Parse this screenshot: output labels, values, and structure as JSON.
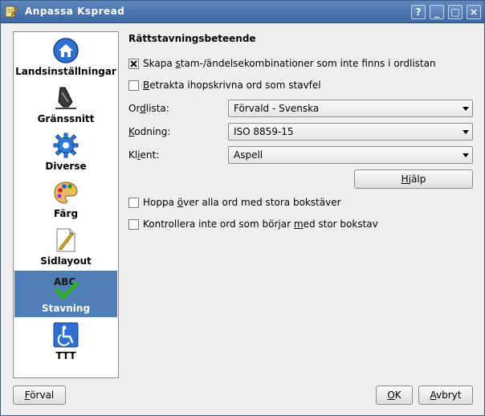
{
  "window": {
    "title": "Anpassa Kspread"
  },
  "titlebar_buttons": {
    "help": "?",
    "minimize": "_",
    "maximize": "□",
    "close": "×"
  },
  "sidebar": {
    "items": [
      {
        "label": "Landsinställningar",
        "icon": "home-icon"
      },
      {
        "label": "Gränssnitt",
        "icon": "pen-nib-icon"
      },
      {
        "label": "Diverse",
        "icon": "gear-icon"
      },
      {
        "label": "Färg",
        "icon": "palette-icon"
      },
      {
        "label": "Sidlayout",
        "icon": "page-layout-icon"
      },
      {
        "label": "Stavning",
        "icon": "abc-spellcheck-icon",
        "active": true
      },
      {
        "label": "TTT",
        "icon": "accessibility-icon"
      }
    ]
  },
  "main": {
    "section_title": "Rättstavningsbeteende",
    "checkbox_stem": {
      "before": "Skapa ",
      "mnemonic": "s",
      "after": "tam-/ändelsekombinationer som inte finns i ordlistan",
      "checked": true
    },
    "checkbox_compound": {
      "before": "",
      "mnemonic": "B",
      "after": "etrakta ihopskrivna ord som stavfel",
      "checked": false
    },
    "dictionary": {
      "label_before": "Or",
      "label_mnemonic": "d",
      "label_after": "lista:",
      "value": "Förvald - Svenska"
    },
    "encoding": {
      "label_before": "",
      "label_mnemonic": "K",
      "label_after": "odning:",
      "value": "ISO 8859-15"
    },
    "client": {
      "label_before": "Kl",
      "label_mnemonic": "i",
      "label_after": "ent:",
      "value": "Aspell"
    },
    "help_button": {
      "before": "",
      "mnemonic": "H",
      "after": "jälp"
    },
    "checkbox_uppercase": {
      "before": "Hoppa ",
      "mnemonic": "ö",
      "after": "ver alla ord med stora bokstäver",
      "checked": false
    },
    "checkbox_capitalized": {
      "before": "Kontrollera inte ord som börjar ",
      "mnemonic": "m",
      "after": "ed stor bokstav",
      "checked": false
    }
  },
  "footer": {
    "default_button": {
      "before": "",
      "mnemonic": "F",
      "after": "örval"
    },
    "ok_button": {
      "before": "",
      "mnemonic": "O",
      "after": "K"
    },
    "cancel_button": {
      "before": "",
      "mnemonic": "A",
      "after": "vbryt"
    }
  },
  "colors": {
    "titlebar": "#4a72ad",
    "selection": "#4f7fb6",
    "window_bg": "#efefef"
  }
}
